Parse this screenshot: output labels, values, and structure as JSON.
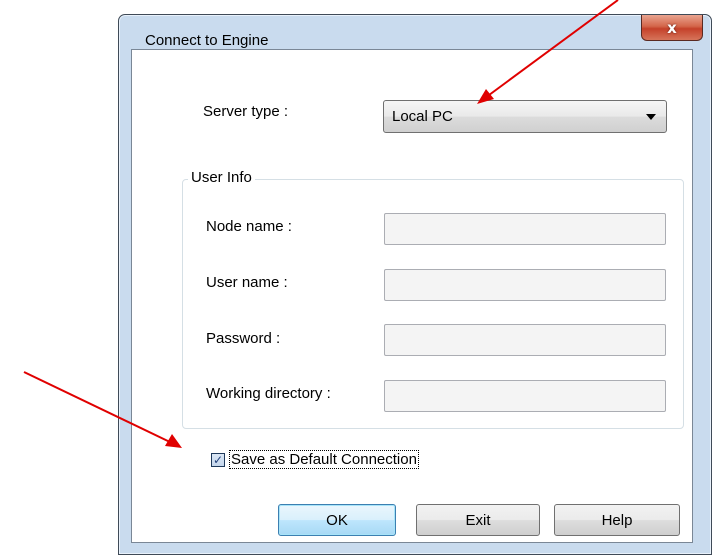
{
  "window": {
    "title": "Connect to Engine",
    "close_glyph": "x"
  },
  "server": {
    "label": "Server type :",
    "selected": "Local PC"
  },
  "user_info": {
    "legend": "User Info",
    "fields": [
      {
        "label": "Node name :",
        "value": ""
      },
      {
        "label": "User name :",
        "value": ""
      },
      {
        "label": "Password :",
        "value": ""
      },
      {
        "label": "Working directory :",
        "value": ""
      }
    ]
  },
  "default_connection": {
    "label": "Save as Default Connection",
    "checked": true
  },
  "buttons": {
    "ok": "OK",
    "exit": "Exit",
    "help": "Help"
  },
  "annotation_color": "#e00000"
}
